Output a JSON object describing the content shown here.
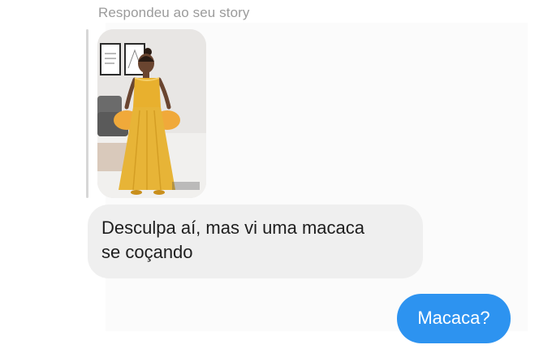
{
  "chat": {
    "reply_caption": "Respondeu ao seu story",
    "story_thumbnail": {
      "icon": "story-photo"
    },
    "received_message": {
      "line1": "Desculpa aí, mas vi uma macaca",
      "line2": "se coçando"
    },
    "sent_message": {
      "text": "Macaca?"
    }
  },
  "colors": {
    "received_bubble": "#efefef",
    "sent_bubble": "#2d93f0",
    "caption_text": "#9b9b9b",
    "message_text": "#1e1e1e"
  }
}
